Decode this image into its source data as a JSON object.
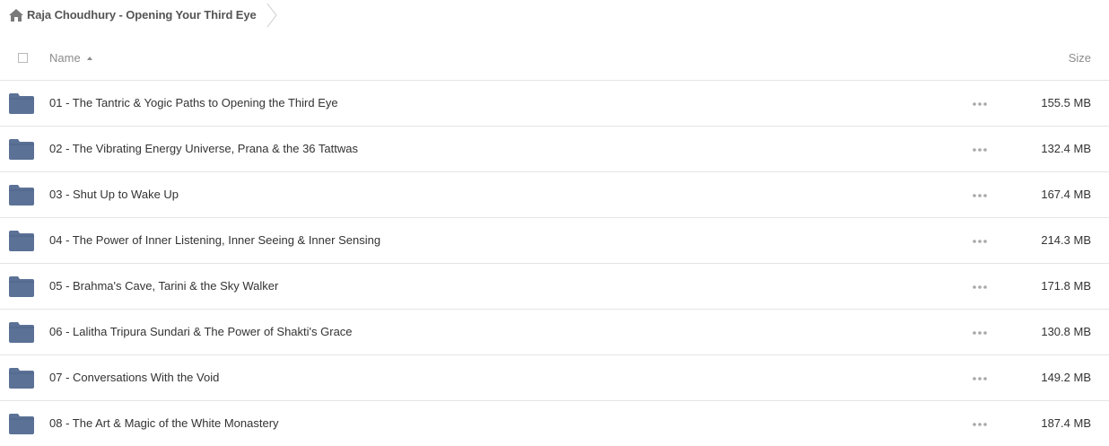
{
  "breadcrumb": {
    "icon": "home-icon",
    "title": "Raja Choudhury - Opening Your Third Eye"
  },
  "header": {
    "name_label": "Name",
    "size_label": "Size",
    "sort": "ascending"
  },
  "colors": {
    "folder": "#5b7196",
    "text": "#333333",
    "muted": "#8c8c8c",
    "divider": "#e5e5e5"
  },
  "rows": [
    {
      "name": "01 - The Tantric & Yogic Paths to Opening the Third Eye",
      "size": "155.5 MB"
    },
    {
      "name": "02 - The Vibrating Energy Universe, Prana & the 36 Tattwas",
      "size": "132.4 MB"
    },
    {
      "name": "03 - Shut Up to Wake Up",
      "size": "167.4 MB"
    },
    {
      "name": "04 - The Power of Inner Listening, Inner Seeing & Inner Sensing",
      "size": "214.3 MB"
    },
    {
      "name": "05 - Brahma's Cave, Tarini & the Sky Walker",
      "size": "171.8 MB"
    },
    {
      "name": "06 - Lalitha Tripura Sundari & The Power of Shakti's Grace",
      "size": "130.8 MB"
    },
    {
      "name": "07 - Conversations With the Void",
      "size": "149.2 MB"
    },
    {
      "name": "08 - The Art & Magic of the White Monastery",
      "size": "187.4 MB"
    }
  ]
}
